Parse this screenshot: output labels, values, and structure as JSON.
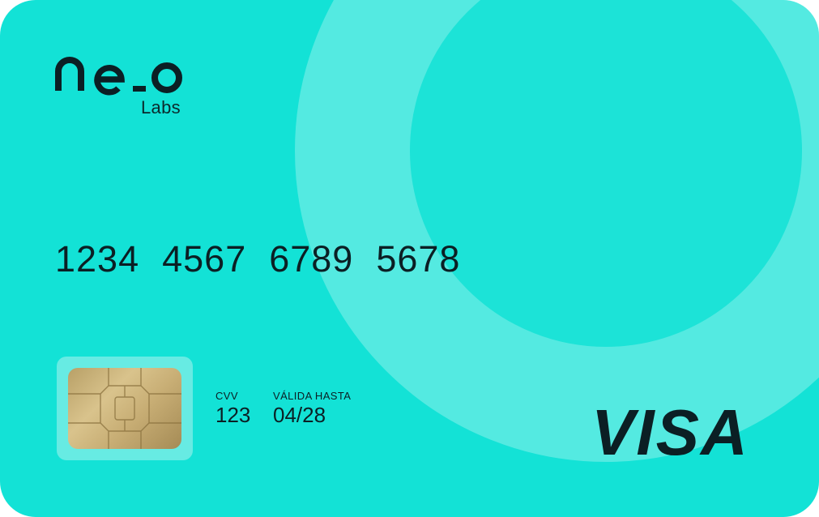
{
  "card": {
    "background_color": "#13e2d6",
    "brand": {
      "logo_text": "ne.o",
      "logo_sub": "Labs"
    },
    "number_groups": [
      "1234",
      "4567",
      "6789",
      "5678"
    ],
    "cvv": {
      "label": "CVV",
      "value": "123"
    },
    "expiry": {
      "label": "VÁLIDA HASTA",
      "value": "04/28"
    },
    "network": "VISA"
  }
}
